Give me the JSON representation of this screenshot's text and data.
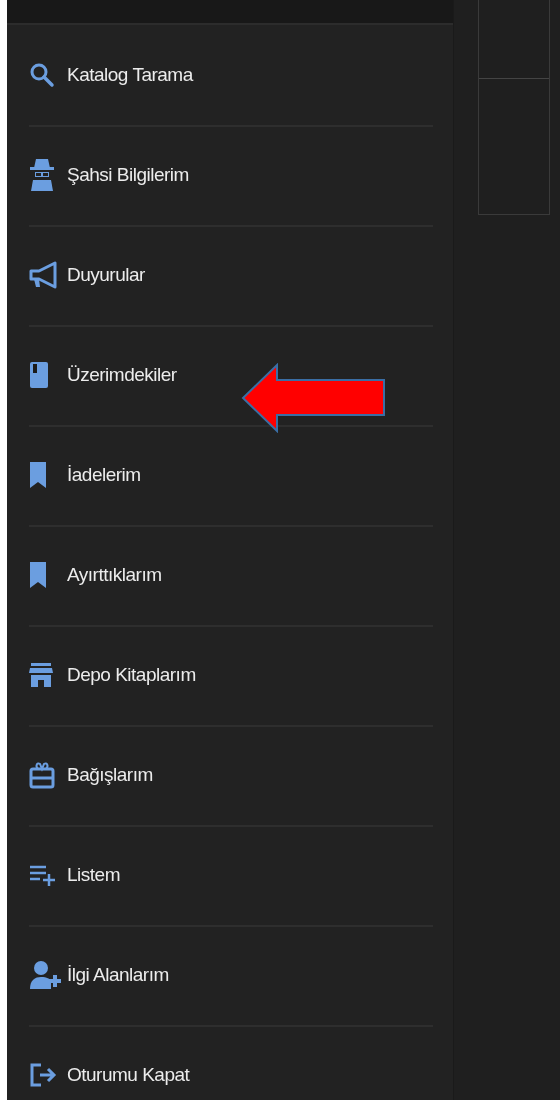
{
  "menu": {
    "items": [
      {
        "label": "Katalog Tarama"
      },
      {
        "label": "Şahsi Bilgilerim"
      },
      {
        "label": "Duyurular"
      },
      {
        "label": "Üzerimdekiler"
      },
      {
        "label": "İadelerim"
      },
      {
        "label": "Ayırttıklarım"
      },
      {
        "label": "Depo Kitaplarım"
      },
      {
        "label": "Bağışlarım"
      },
      {
        "label": "Listem"
      },
      {
        "label": "İlgi Alanlarım"
      },
      {
        "label": "Oturumu Kapat"
      }
    ]
  }
}
